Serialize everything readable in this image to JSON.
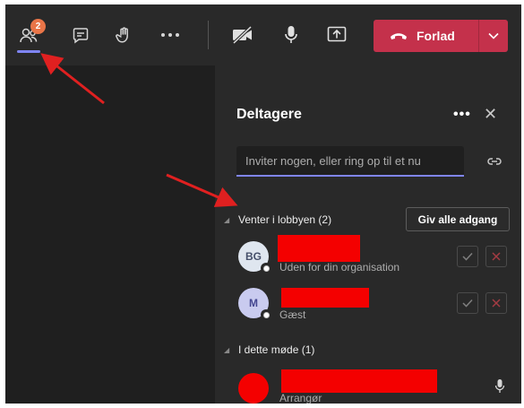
{
  "toolbar": {
    "participants_badge": "2",
    "leave_label": "Forlad"
  },
  "panel": {
    "title": "Deltagere",
    "invite_placeholder": "Inviter nogen, eller ring op til et nu",
    "lobby": {
      "label": "Venter i lobbyen (2)",
      "admit_all_label": "Giv alle adgang",
      "people": [
        {
          "initials": "BG",
          "subtitle": "Uden for din organisation"
        },
        {
          "initials": "M",
          "subtitle": "Gæst"
        }
      ]
    },
    "in_meeting": {
      "label": "I dette møde (1)",
      "people": [
        {
          "initials": "",
          "subtitle": "Arrangør"
        }
      ]
    }
  },
  "colors": {
    "accent": "#7f85f5",
    "leave": "#c4314b",
    "annotation": "#e02020",
    "redaction": "#f40000"
  }
}
